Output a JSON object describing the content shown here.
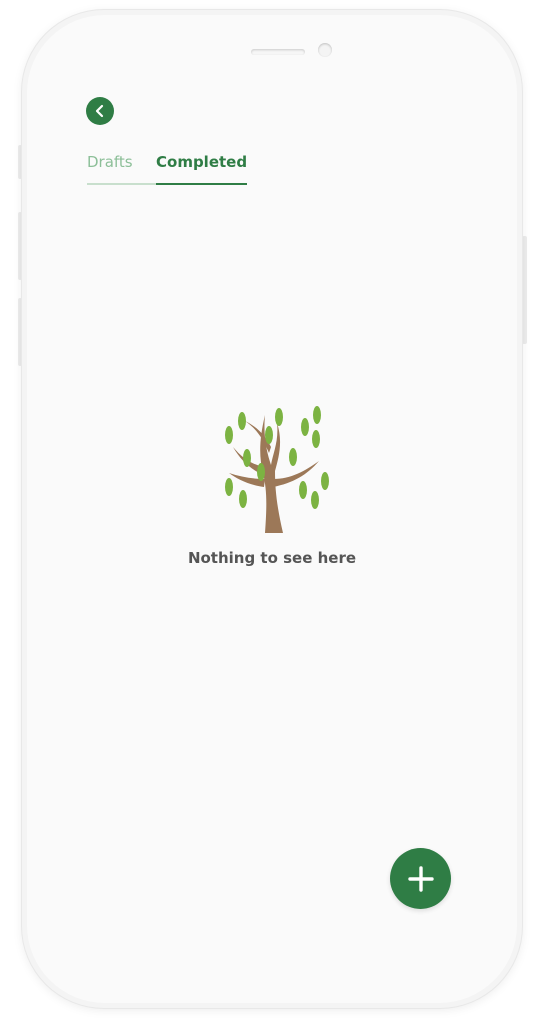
{
  "header": {
    "back_icon": "chevron-left-icon"
  },
  "tabs": [
    {
      "label": "Drafts",
      "active": false
    },
    {
      "label": "Completed",
      "active": true
    }
  ],
  "empty_state": {
    "illustration": "tree-icon",
    "message": "Nothing to see here"
  },
  "fab": {
    "icon": "plus-icon"
  },
  "colors": {
    "primary": "#2f7d45",
    "tab_inactive": "#8cbf98",
    "leaf": "#7cb342",
    "trunk": "#9c7858",
    "text": "#555555"
  }
}
